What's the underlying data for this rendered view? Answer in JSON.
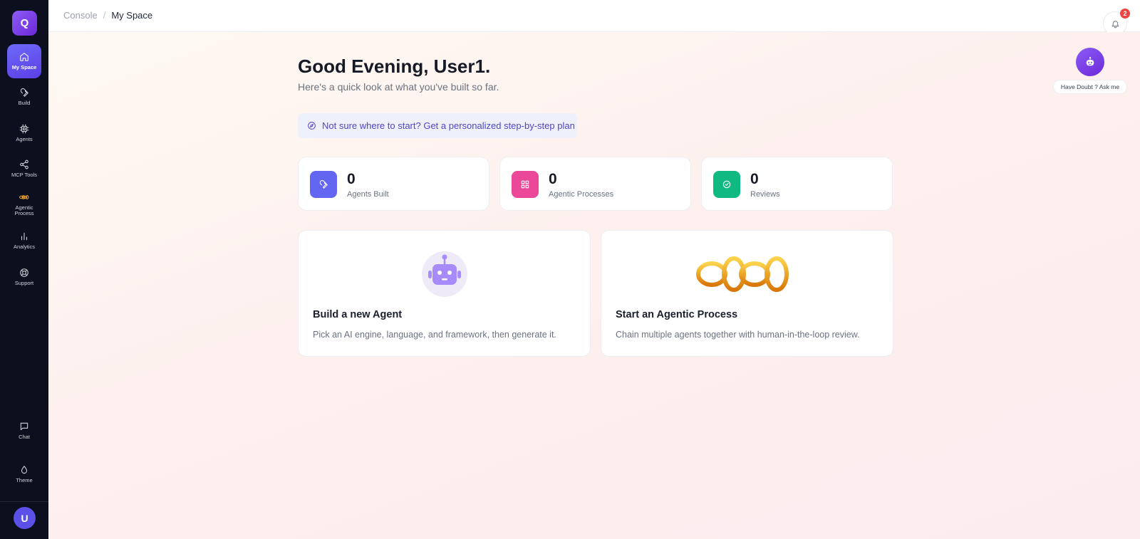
{
  "app": {
    "logo_letter": "Q"
  },
  "sidebar": {
    "items": [
      {
        "label": "My Space",
        "icon": "home-icon",
        "active": true
      },
      {
        "label": "Build",
        "icon": "wrench-icon"
      },
      {
        "label": "Agents",
        "icon": "cpu-icon"
      },
      {
        "label": "MCP Tools",
        "icon": "share-nodes-icon"
      },
      {
        "label": "Agentic\nProcess",
        "icon": "chain-links-icon"
      },
      {
        "label": "Analytics",
        "icon": "bar-chart-icon"
      },
      {
        "label": "Support",
        "icon": "lifebuoy-icon"
      }
    ],
    "bottom_items": [
      {
        "label": "Chat",
        "icon": "chat-bubble-icon"
      },
      {
        "label": "Theme",
        "icon": "droplet-icon"
      }
    ],
    "user_initial": "U"
  },
  "header": {
    "breadcrumb": {
      "parent": "Console",
      "separator": "/",
      "current": "My Space"
    },
    "notification_count": "2"
  },
  "main": {
    "greeting": "Good Evening, User1.",
    "subtitle": "Here's a quick look at what you've built so far.",
    "plan_link": "Not sure where to start? Get a personalized step-by-step plan",
    "stats": [
      {
        "value": "0",
        "label": "Agents Built",
        "icon": "wrench-icon",
        "color": "#6366f1"
      },
      {
        "value": "0",
        "label": "Agentic Processes",
        "icon": "grid-icon",
        "color": "#ec4899"
      },
      {
        "value": "0",
        "label": "Reviews",
        "icon": "check-circle-icon",
        "color": "#10b981"
      }
    ],
    "cards": [
      {
        "title": "Build a new Agent",
        "description": "Pick an AI engine, language, and framework, then generate it.",
        "illustration": "robot-icon"
      },
      {
        "title": "Start an Agentic Process",
        "description": "Chain multiple agents together with human-in-the-loop review.",
        "illustration": "golden-chain-icon"
      }
    ]
  },
  "assistant": {
    "tooltip": "Have Doubt ? Ask me",
    "icon": "robot-face-icon"
  },
  "colors": {
    "sidebar_bg": "#0b0f1e",
    "accent": "#5b50e8",
    "badge": "#ef4444"
  }
}
